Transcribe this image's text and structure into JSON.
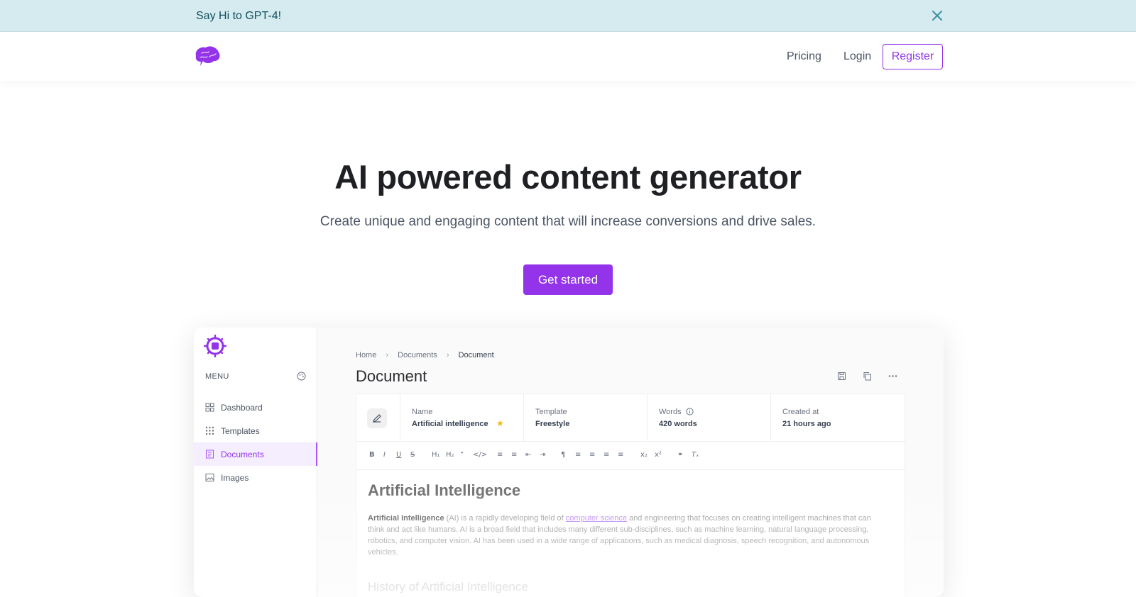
{
  "banner": {
    "text": "Say Hi to GPT-4!"
  },
  "nav": {
    "pricing": "Pricing",
    "login": "Login",
    "register": "Register"
  },
  "hero": {
    "title": "AI powered content generator",
    "subtitle": "Create unique and engaging content that will increase conversions and drive sales.",
    "cta": "Get started"
  },
  "app": {
    "menu_label": "MENU",
    "sidebar": [
      {
        "label": "Dashboard",
        "icon": "dashboard-icon"
      },
      {
        "label": "Templates",
        "icon": "grid-icon"
      },
      {
        "label": "Documents",
        "icon": "document-icon",
        "active": true
      },
      {
        "label": "Images",
        "icon": "image-icon"
      }
    ],
    "breadcrumb": [
      "Home",
      "Documents",
      "Document"
    ],
    "page_title": "Document",
    "meta": {
      "name_key": "Name",
      "name_value": "Artificial intelligence",
      "template_key": "Template",
      "template_value": "Freestyle",
      "words_key": "Words",
      "words_value": "420 words",
      "created_key": "Created at",
      "created_value": "21 hours ago"
    },
    "article": {
      "heading": "Artificial Intelligence",
      "p_bold": "Artificial Intelligence",
      "p_a": " (AI) is a rapidly developing field of ",
      "p_link": "computer science",
      "p_b": " and engineering that focuses on creating intelligent machines that can think and act like humans. AI is a broad field that includes many different sub-disciplines, such as machine learning, natural language processing, robotics, and computer vision. AI has been used in a wide range of applications, such as medical diagnosis, speech recognition, and autonomous vehicles.",
      "subheading": "History of Artificial Intelligence"
    }
  },
  "colors": {
    "accent": "#9333ea",
    "banner_bg": "#d5ebef"
  }
}
